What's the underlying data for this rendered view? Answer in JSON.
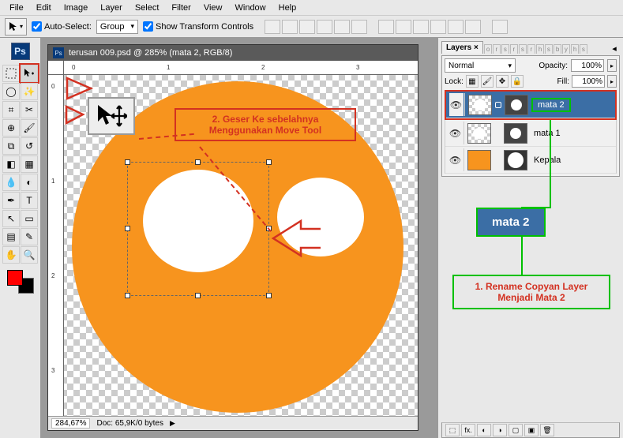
{
  "menu": {
    "items": [
      "File",
      "Edit",
      "Image",
      "Layer",
      "Select",
      "Filter",
      "View",
      "Window",
      "Help"
    ]
  },
  "options": {
    "auto_select": "Auto-Select:",
    "group": "Group",
    "show_transform": "Show Transform Controls"
  },
  "app_badge": "Ps",
  "document": {
    "title": "terusan 009.psd @ 285% (mata 2, RGB/8)",
    "zoom_status": "284,67%",
    "doc_info": "Doc: 65,9K/0 bytes"
  },
  "annotations": {
    "red_note": "2. Geser Ke sebelahnya Menggunakan Move Tool",
    "green_note": "1. Rename Copyan Layer Menjadi Mata 2",
    "badge_text": "mata 2"
  },
  "panel": {
    "tab_layers": "Layers",
    "blend_mode": "Normal",
    "opacity_label": "Opacity:",
    "opacity_value": "100%",
    "lock_label": "Lock:",
    "fill_label": "Fill:",
    "fill_value": "100%",
    "layers": [
      {
        "name": "mata 2",
        "selected": true,
        "editing": true
      },
      {
        "name": "mata 1",
        "selected": false
      },
      {
        "name": "Kepala",
        "selected": false,
        "thumb_color": "#f7941e"
      }
    ]
  },
  "ruler_h": [
    "0",
    "1",
    "2",
    "3"
  ],
  "ruler_v": [
    "0",
    "1",
    "2",
    "3"
  ],
  "icons": {
    "move": "↖✥",
    "eye": "👁"
  }
}
